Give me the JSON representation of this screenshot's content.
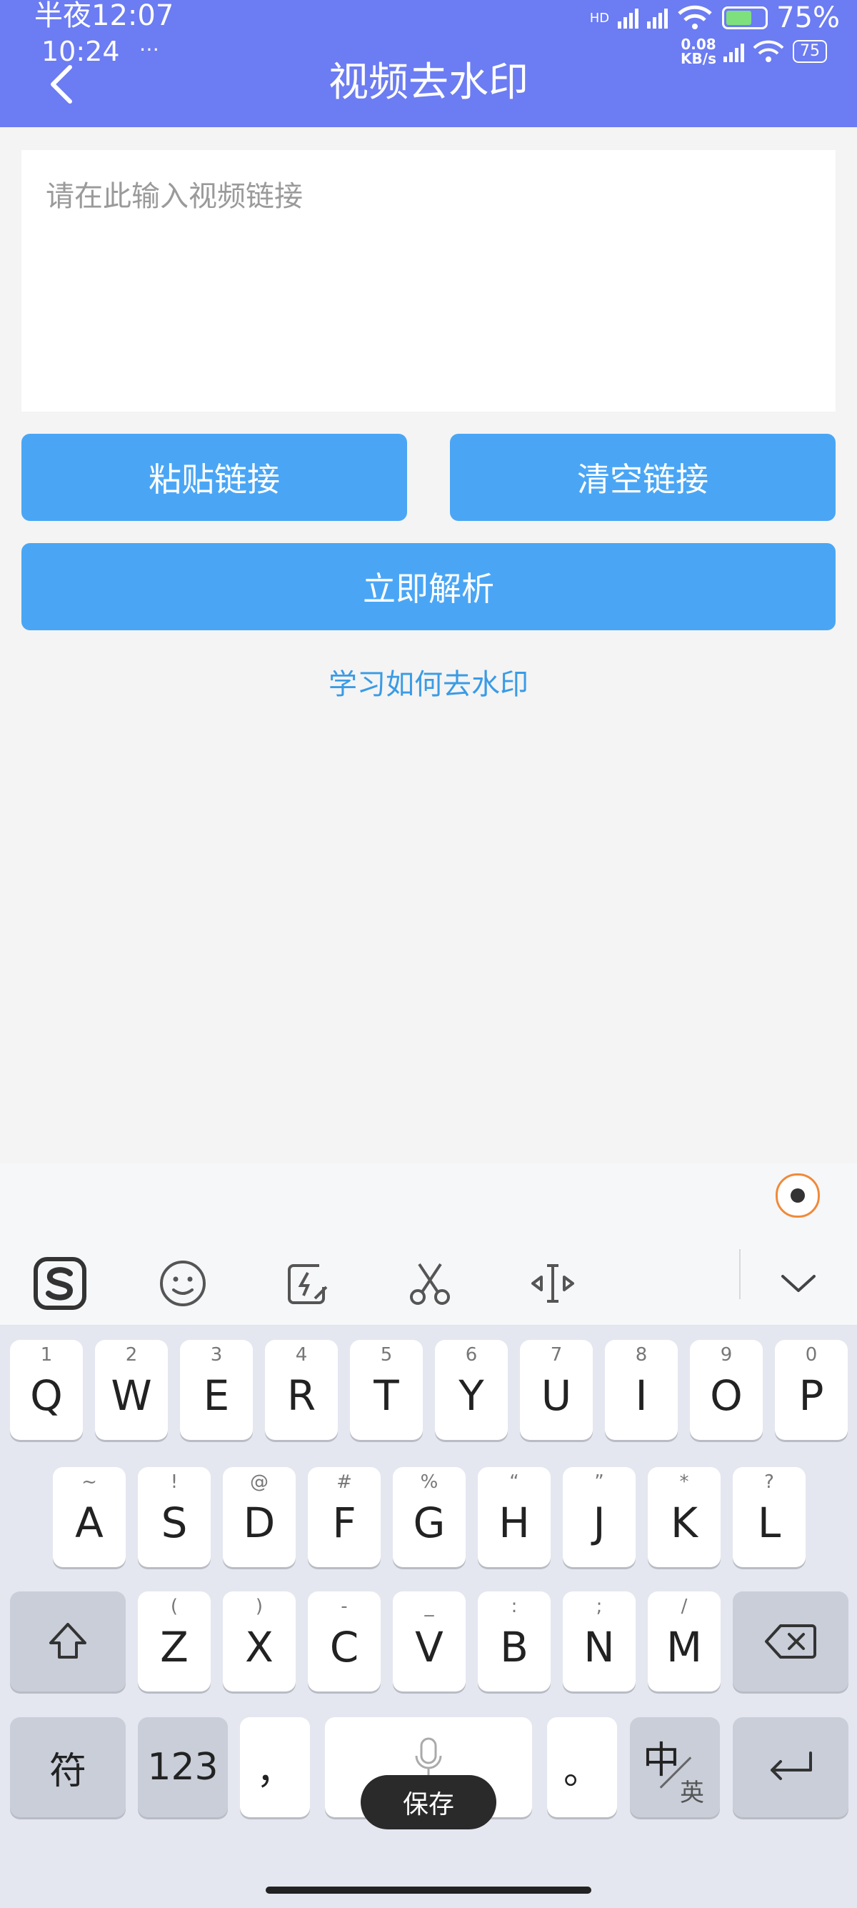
{
  "status_bar_outer": {
    "time": "半夜12:07",
    "network": "HD",
    "battery": "75%"
  },
  "status_bar_inner": {
    "time": "10:24",
    "extra": "⋯",
    "speed_value": "0.08",
    "speed_unit": "KB/s",
    "battery": "75"
  },
  "header": {
    "title": "视频去水印"
  },
  "url_input": {
    "placeholder": "请在此输入视频链接"
  },
  "buttons": {
    "paste": "粘贴链接",
    "clear": "清空链接",
    "parse": "立即解析"
  },
  "learn_link": "学习如何去水印",
  "keyboard": {
    "row1": [
      {
        "hint": "1",
        "key": "Q"
      },
      {
        "hint": "2",
        "key": "W"
      },
      {
        "hint": "3",
        "key": "E"
      },
      {
        "hint": "4",
        "key": "R"
      },
      {
        "hint": "5",
        "key": "T"
      },
      {
        "hint": "6",
        "key": "Y"
      },
      {
        "hint": "7",
        "key": "U"
      },
      {
        "hint": "8",
        "key": "I"
      },
      {
        "hint": "9",
        "key": "O"
      },
      {
        "hint": "0",
        "key": "P"
      }
    ],
    "row2": [
      {
        "hint": "~",
        "key": "A"
      },
      {
        "hint": "!",
        "key": "S"
      },
      {
        "hint": "@",
        "key": "D"
      },
      {
        "hint": "#",
        "key": "F"
      },
      {
        "hint": "%",
        "key": "G"
      },
      {
        "hint": "“",
        "key": "H"
      },
      {
        "hint": "”",
        "key": "J"
      },
      {
        "hint": "*",
        "key": "K"
      },
      {
        "hint": "?",
        "key": "L"
      }
    ],
    "row3": [
      {
        "hint": "(",
        "key": "Z"
      },
      {
        "hint": ")",
        "key": "X"
      },
      {
        "hint": "-",
        "key": "C"
      },
      {
        "hint": "_",
        "key": "V"
      },
      {
        "hint": ":",
        "key": "B"
      },
      {
        "hint": ";",
        "key": "N"
      },
      {
        "hint": "/",
        "key": "M"
      }
    ],
    "symbols_label": "符",
    "numbers_label": "123",
    "comma_label": "，",
    "period_label": "。",
    "lang_main": "中",
    "lang_sub": "英"
  },
  "toast": "保存",
  "colors": {
    "header": "#6c7cf2",
    "button": "#4aa6f5",
    "link": "#3a9be5"
  }
}
